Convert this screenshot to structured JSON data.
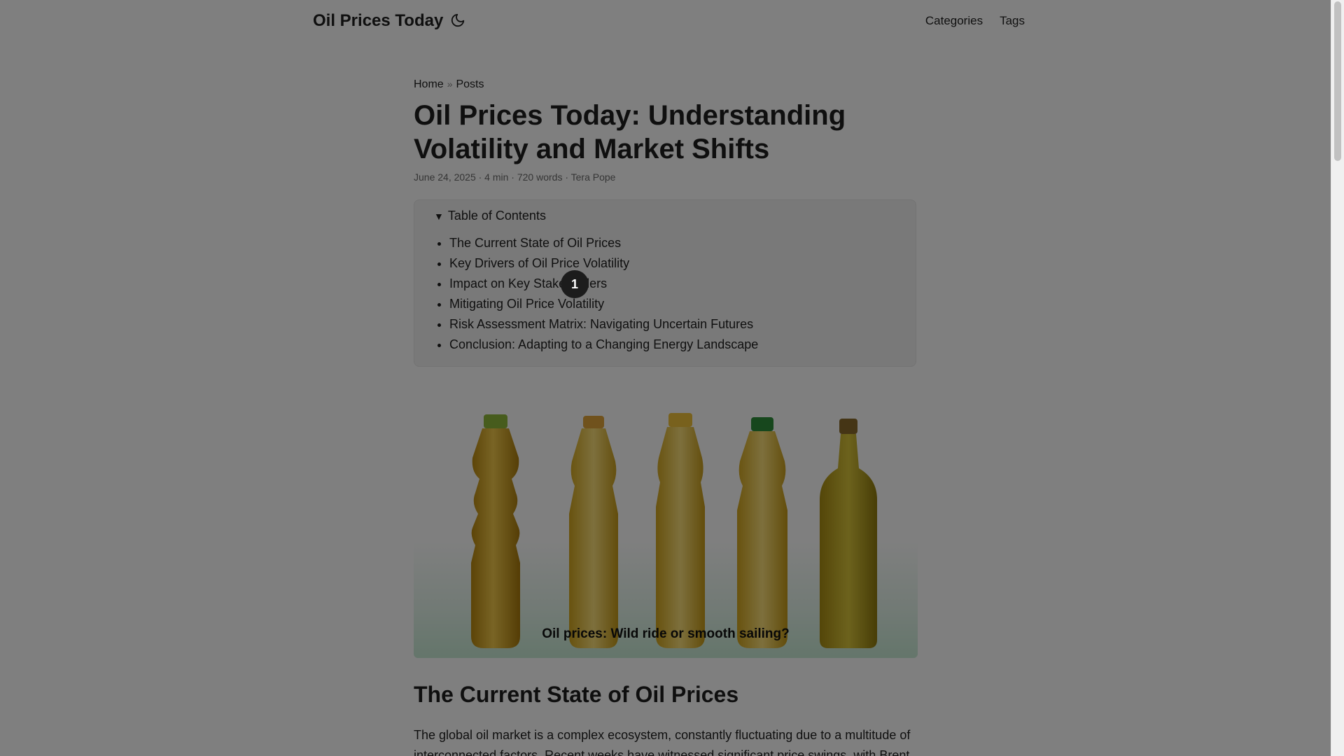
{
  "header": {
    "site_title": "Oil Prices Today",
    "theme_icon": "moon-icon",
    "nav": [
      "Categories",
      "Tags"
    ]
  },
  "breadcrumb": {
    "home": "Home",
    "separator": "»",
    "posts": "Posts"
  },
  "post": {
    "title": "Oil Prices Today: Understanding Volatility and Market Shifts",
    "meta": "June 24, 2025 · 4 min · 720 words · Tera Pope"
  },
  "toc": {
    "summary": "Table of Contents",
    "items": [
      "The Current State of Oil Prices",
      "Key Drivers of Oil Price Volatility",
      "Impact on Key Stakeholders",
      "Mitigating Oil Price Volatility",
      "Risk Assessment Matrix: Navigating Uncertain Futures",
      "Conclusion: Adapting to a Changing Energy Landscape"
    ]
  },
  "cover": {
    "caption": "Oil prices: Wild ride or smooth sailing?"
  },
  "content": {
    "heading": "The Current State of Oil Prices",
    "paragraph": "The global oil market is a complex ecosystem, constantly fluctuating due to a multitude of interconnected factors. Recent weeks have witnessed significant price swings, with Brent"
  },
  "overlay": {
    "marker_label": "1"
  },
  "colors": {
    "overlay": "#000000",
    "toc_background": "#f2f2f2",
    "oil": "#d9a81c",
    "cap_green": "#2f8f3a",
    "cap_yellow": "#e0b12a"
  }
}
